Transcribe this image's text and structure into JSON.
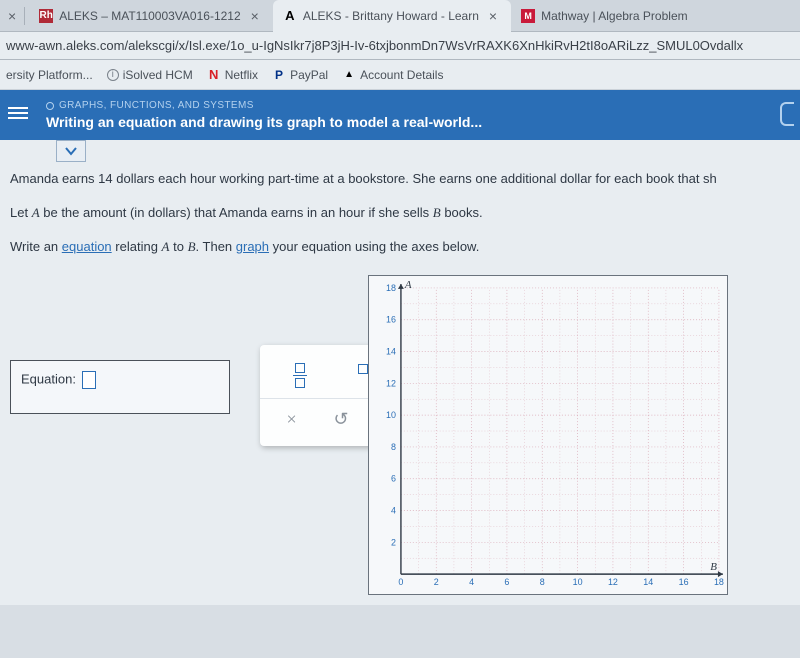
{
  "tabs": [
    {
      "favicon": "Rh",
      "label": "ALEKS – MAT110003VA016-1212"
    },
    {
      "favicon": "A",
      "label": "ALEKS - Brittany Howard - Learn"
    },
    {
      "favicon": "M",
      "label": "Mathway | Algebra Problem"
    }
  ],
  "url": "www-awn.aleks.com/alekscgi/x/Isl.exe/1o_u-IgNsIkr7j8P3jH-Iv-6txjbonmDn7WsVrRAXK6XnHkiRvH2tI8oARiLzz_SMUL0Ovdallx",
  "bookmarks": [
    {
      "icon": "",
      "label": "ersity Platform..."
    },
    {
      "icon": "i",
      "label": "iSolved HCM"
    },
    {
      "icon": "N",
      "label": "Netflix"
    },
    {
      "icon": "P",
      "label": "PayPal"
    },
    {
      "icon": "A",
      "label": "Account Details"
    }
  ],
  "banner": {
    "crumb": "GRAPHS, FUNCTIONS, AND SYSTEMS",
    "title": "Writing an equation and drawing its graph to model a real-world..."
  },
  "problem": {
    "p1a": "Amanda earns ",
    "p1b": " dollars each hour working part-time at a bookstore. She earns one additional dollar for each book that sh",
    "rate": "14",
    "p2a": "Let ",
    "p2b": " be the amount (in dollars) that Amanda earns in an hour if she sells ",
    "p2c": " books.",
    "varA": "A",
    "varB": "B",
    "p3a": "Write an ",
    "p3b": " relating ",
    "p3c": " to ",
    "p3d": ". Then ",
    "p3e": " your equation using the axes below.",
    "link_eq": "equation",
    "link_graph": "graph"
  },
  "equation": {
    "label": "Equation:"
  },
  "tools": {
    "clear": "×",
    "reset": "↺",
    "help": "?"
  },
  "chart_data": {
    "type": "scatter",
    "series": [],
    "xlabel": "B",
    "ylabel": "A",
    "xlim": [
      0,
      18
    ],
    "ylim": [
      0,
      18
    ],
    "xticks": [
      0,
      2,
      4,
      6,
      8,
      10,
      12,
      14,
      16,
      18
    ],
    "yticks": [
      2,
      4,
      6,
      8,
      10,
      12,
      14,
      16,
      18
    ],
    "grid": true
  }
}
